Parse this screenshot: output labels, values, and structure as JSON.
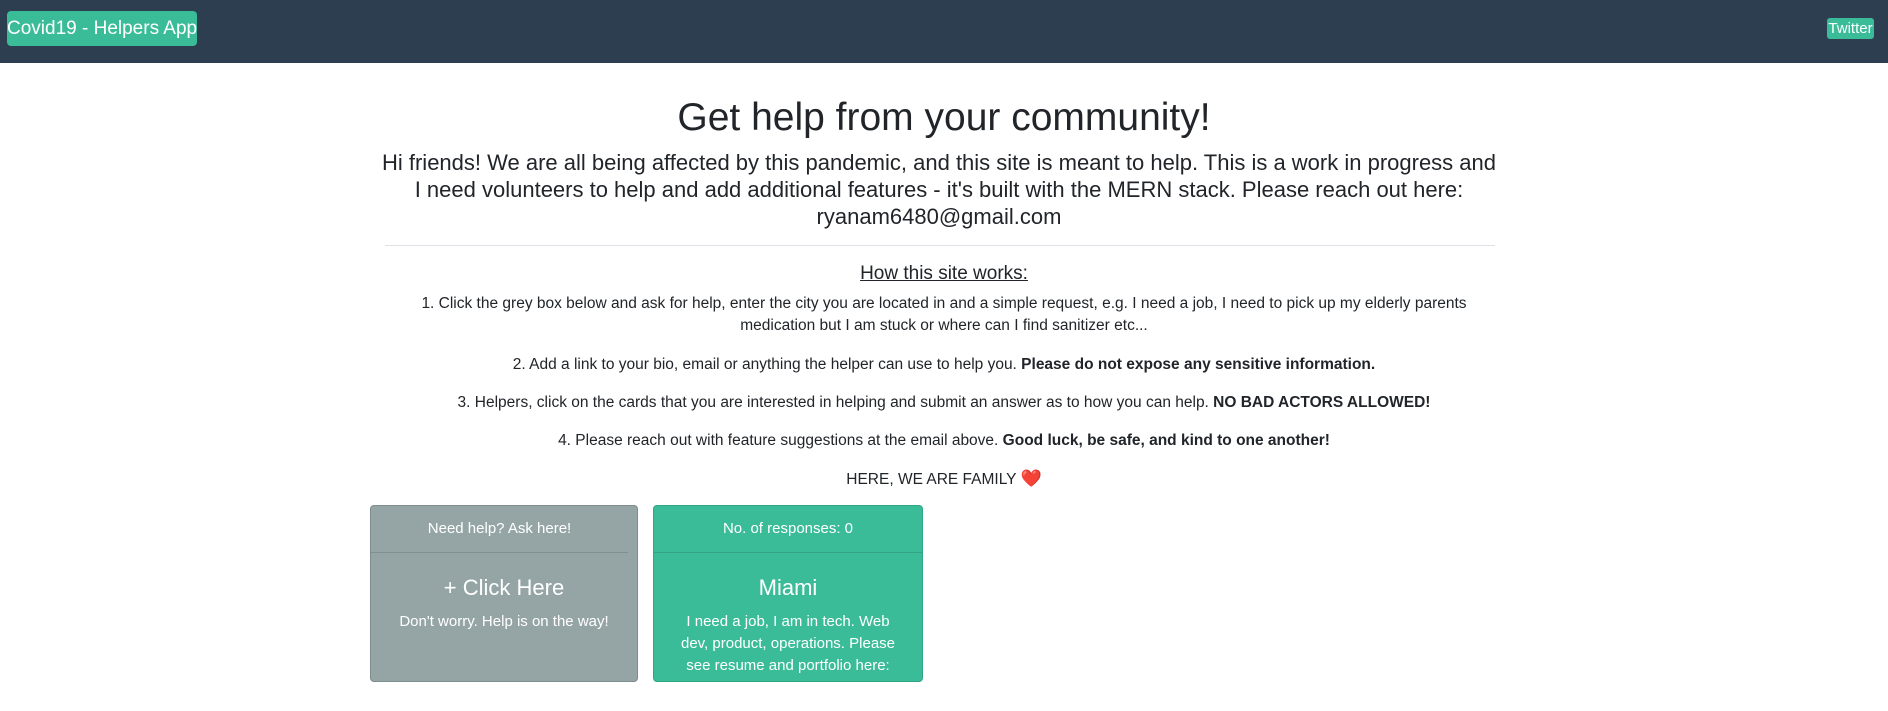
{
  "navbar": {
    "brand": "Covid19 - Helpers App",
    "twitter_label": "Twitter",
    "background": "#2c3e50",
    "accent": "#3bbc99"
  },
  "hero": {
    "headline": "Get help from your community!",
    "intro": "Hi friends! We are all being affected by this pandemic, and this site is meant to help. This is a work in progress and I need volunteers to help and add additional features - it's built with the MERN stack. Please reach out here: ryanam6480@gmail.com"
  },
  "how": {
    "title": "How this site works:",
    "step1": "1. Click the grey box below and ask for help, enter the city you are located in and a simple request, e.g. I need a job, I need to pick up my elderly parents medication but I am stuck or where can I find sanitizer etc...",
    "step2_text": "2. Add a link to your bio, email or anything the helper can use to help you. ",
    "step2_bold": "Please do not expose any sensitive information.",
    "step3_text": "3. Helpers, click on the cards that you are interested in helping and submit an answer as to how you can help. ",
    "step3_bold": "NO BAD ACTORS ALLOWED!",
    "step4_text": "4. Please reach out with feature suggestions at the email above. ",
    "step4_bold": "Good luck, be safe, and kind to one another!",
    "family_text": "HERE, WE ARE FAMILY ",
    "heart_icon": "❤️"
  },
  "ask_card": {
    "header": "Need help? Ask here!",
    "title": "+ Click Here",
    "text": "Don't worry. Help is on the way!",
    "color": "#95a5a6"
  },
  "request_cards": [
    {
      "header": "No. of responses: 0",
      "city": "Miami",
      "text": "I need a job, I am in tech. Web dev, product, operations. Please see resume and portfolio here:",
      "color": "#3bbc99"
    }
  ]
}
